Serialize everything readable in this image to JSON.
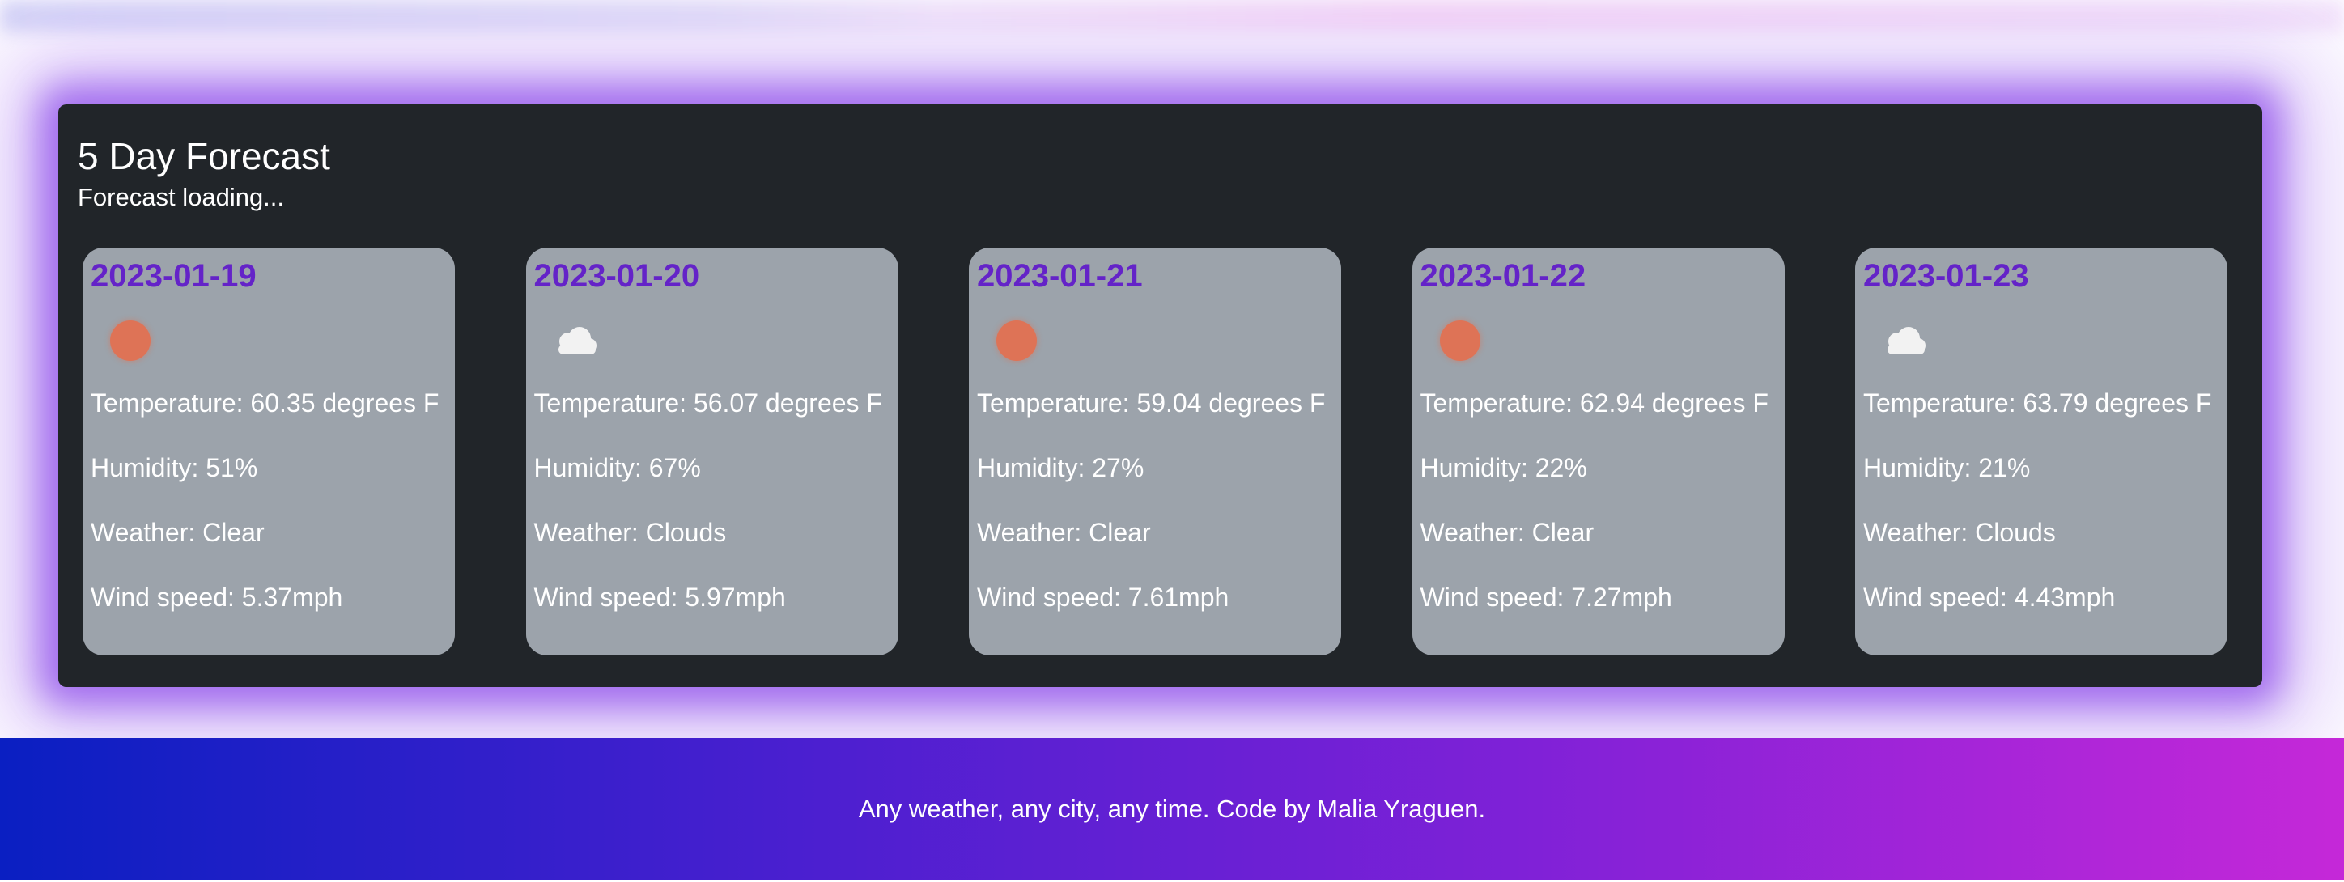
{
  "forecast": {
    "title": "5 Day Forecast",
    "status": "Forecast loading...",
    "days": [
      {
        "date": "2023-01-19",
        "icon": "sun-icon",
        "temperature": "Temperature: 60.35 degrees F",
        "humidity": "Humidity: 51%",
        "weather": "Weather: Clear",
        "wind": "Wind speed: 5.37mph"
      },
      {
        "date": "2023-01-20",
        "icon": "cloud-icon",
        "temperature": "Temperature: 56.07 degrees F",
        "humidity": "Humidity: 67%",
        "weather": "Weather: Clouds",
        "wind": "Wind speed: 5.97mph"
      },
      {
        "date": "2023-01-21",
        "icon": "sun-icon",
        "temperature": "Temperature: 59.04 degrees F",
        "humidity": "Humidity: 27%",
        "weather": "Weather: Clear",
        "wind": "Wind speed: 7.61mph"
      },
      {
        "date": "2023-01-22",
        "icon": "sun-icon",
        "temperature": "Temperature: 62.94 degrees F",
        "humidity": "Humidity: 22%",
        "weather": "Weather: Clear",
        "wind": "Wind speed: 7.27mph"
      },
      {
        "date": "2023-01-23",
        "icon": "cloud-icon",
        "temperature": "Temperature: 63.79 degrees F",
        "humidity": "Humidity: 21%",
        "weather": "Weather: Clouds",
        "wind": "Wind speed: 4.43mph"
      }
    ]
  },
  "footer": {
    "text": "Any weather, any city, any time. Code by Malia Yraguen."
  },
  "colors": {
    "panel_background": "#212529",
    "card_background": "#9ca3ab",
    "date_text": "#6423c8",
    "sun": "#de7356",
    "cloud": "#f2f2f2",
    "glow": "#965aeb",
    "footer_gradient_start": "#0a1fc2",
    "footer_gradient_end": "#c528d8"
  }
}
